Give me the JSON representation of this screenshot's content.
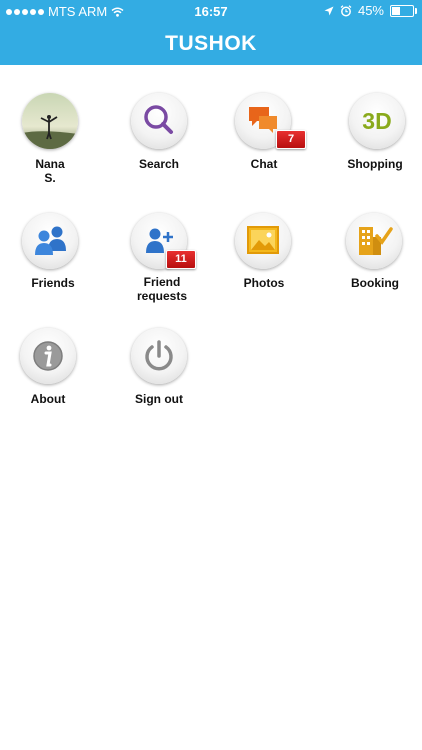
{
  "status_bar": {
    "carrier": "MTS ARM",
    "time": "16:57",
    "battery_percent": "45%",
    "battery_level": 0.45,
    "icons": [
      "signal-dots-icon",
      "wifi-icon",
      "location-arrow-icon",
      "alarm-icon",
      "battery-icon"
    ]
  },
  "header": {
    "title": "TUSHOK",
    "background": "#33ace3"
  },
  "menu": {
    "profile": {
      "label_line1": "Nana",
      "label_line2": "S."
    },
    "search": {
      "label": "Search"
    },
    "chat": {
      "label": "Chat",
      "badge": "7"
    },
    "shopping": {
      "label": "Shopping",
      "icon_text": "3D"
    },
    "friends": {
      "label": "Friends"
    },
    "friend_requests": {
      "label_line1": "Friend",
      "label_line2": "requests",
      "badge": "11"
    },
    "photos": {
      "label": "Photos"
    },
    "booking": {
      "label": "Booking"
    },
    "about": {
      "label": "About"
    },
    "sign_out": {
      "label": "Sign out"
    }
  }
}
